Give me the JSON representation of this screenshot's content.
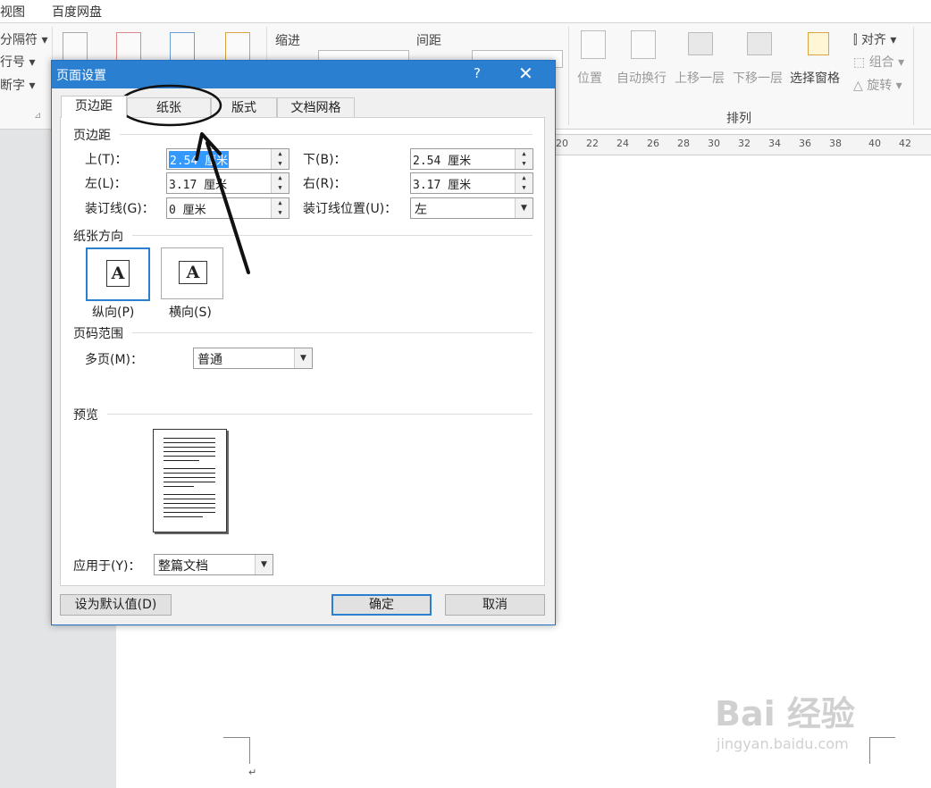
{
  "menubar": {
    "items": [
      "视图",
      "百度网盘"
    ]
  },
  "ribbon": {
    "left_items": [
      "分隔符 ▾",
      "行号 ▾",
      "断字 ▾"
    ],
    "indent_label": "缩进",
    "spacing_label": "间距",
    "arrange_group": "排列",
    "arrange_buttons": [
      "位置",
      "自动换行",
      "上移一层",
      "下移一层",
      "选择窗格"
    ],
    "align_items": [
      "对齐 ▾",
      "组合 ▾",
      "旋转 ▾"
    ]
  },
  "ruler_ticks": [
    "20",
    "22",
    "24",
    "26",
    "28",
    "30",
    "32",
    "34",
    "36",
    "38",
    "40",
    "42"
  ],
  "dialog": {
    "title": "页面设置",
    "help": "?",
    "close": "✕",
    "tabs": [
      "页边距",
      "纸张",
      "版式",
      "文档网格"
    ],
    "margins_section": "页边距",
    "top_label": "上(T)：",
    "top_value": "2.54 厘米",
    "bottom_label": "下(B)：",
    "bottom_value": "2.54 厘米",
    "left_label": "左(L)：",
    "left_value": "3.17 厘米",
    "right_label": "右(R)：",
    "right_value": "3.17 厘米",
    "gutter_label": "装订线(G)：",
    "gutter_value": "0 厘米",
    "gutter_pos_label": "装订线位置(U)：",
    "gutter_pos_value": "左",
    "orientation_section": "纸张方向",
    "portrait_label": "纵向(P)",
    "landscape_label": "横向(S)",
    "orientation_glyph": "A",
    "pages_section": "页码范围",
    "multi_pages_label": "多页(M)：",
    "multi_pages_value": "普通",
    "preview_section": "预览",
    "apply_label": "应用于(Y)：",
    "apply_value": "整篇文档",
    "default_button": "设为默认值(D)",
    "ok_button": "确定",
    "cancel_button": "取消"
  },
  "colors": {
    "title_bar": "#2b7fd0",
    "selection": "#3399ff",
    "annotation": "#111111"
  },
  "watermark": {
    "brand": "Bai 经验",
    "url": "jingyan.baidu.com"
  }
}
